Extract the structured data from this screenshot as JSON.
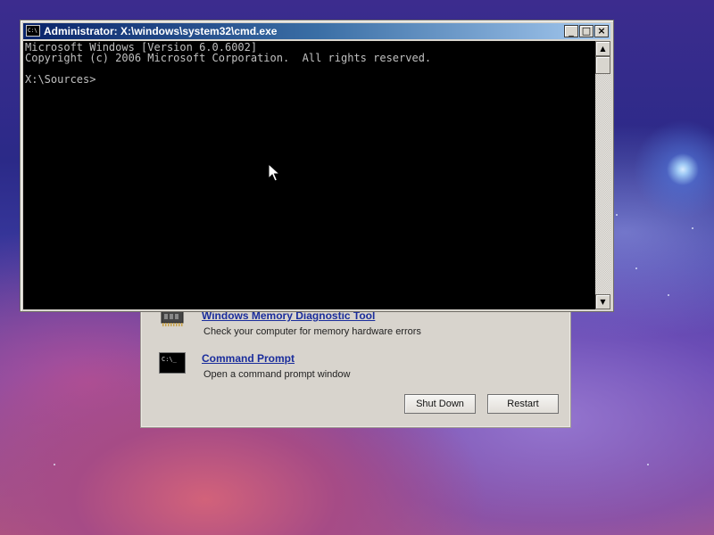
{
  "cmd_window": {
    "title": "Administrator: X:\\windows\\system32\\cmd.exe",
    "icon": "console-app-icon",
    "icon_text": "C:\\",
    "controls": {
      "minimize": "_",
      "maximize": "□",
      "close": "×"
    },
    "console_lines": [
      "Microsoft Windows [Version 6.0.6002]",
      "Copyright (c) 2006 Microsoft Corporation.  All rights reserved.",
      "",
      "X:\\Sources>"
    ],
    "scrollbar": {
      "up_arrow": "▲",
      "down_arrow": "▼"
    }
  },
  "recovery_panel": {
    "items": [
      {
        "title": "Windows Memory Diagnostic Tool",
        "description": "Check your computer for memory hardware errors",
        "icon": "memory-chip-icon"
      },
      {
        "title": "Command Prompt",
        "description": "Open a command prompt window",
        "icon": "command-prompt-icon",
        "icon_text": "C:\\_"
      }
    ],
    "buttons": {
      "shut_down": "Shut Down",
      "restart": "Restart"
    }
  },
  "colors": {
    "titlebar_start": "#0a246a",
    "titlebar_end": "#a6caf0",
    "console_bg": "#000000",
    "console_text": "#c0c0c0",
    "link": "#1a2d9c",
    "panel_bg": "#d8d4cd"
  }
}
